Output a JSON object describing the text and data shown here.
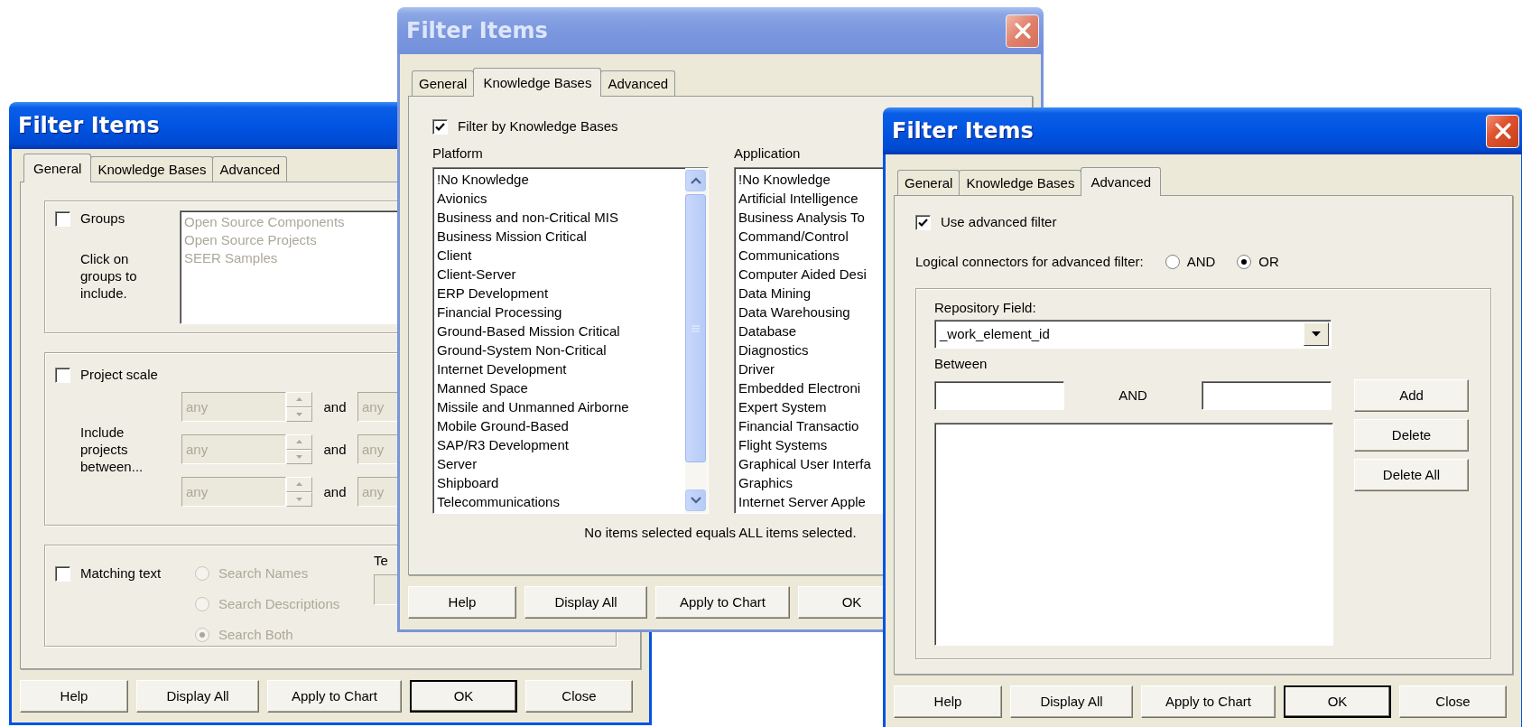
{
  "windows": [
    {
      "title": "Filter Items",
      "active": true,
      "tabs": [
        {
          "label": "General",
          "selected": true
        },
        {
          "label": "Knowledge Bases",
          "selected": false
        },
        {
          "label": "Advanced",
          "selected": false
        }
      ],
      "panel": {
        "kind": "general",
        "groups": {
          "label": "Groups",
          "checked": false,
          "hint": "Click on groups to include.",
          "disabled": true,
          "items": [
            "Open Source Components",
            "Open Source Projects",
            "SEER Samples"
          ]
        },
        "project_scale": {
          "label": "Project scale",
          "checked": false,
          "hint": "Include projects between...",
          "rows": [
            {
              "from": "any",
              "joiner": "and",
              "to": "any",
              "disabled": true
            },
            {
              "from": "any",
              "joiner": "and",
              "to": "any",
              "disabled": true
            },
            {
              "from": "any",
              "joiner": "and",
              "to": "any",
              "disabled": true
            }
          ]
        },
        "matching_text": {
          "label": "Matching text",
          "checked": false,
          "options": [
            {
              "label": "Search Names",
              "selected": false,
              "disabled": true
            },
            {
              "label": "Search Descriptions",
              "selected": false,
              "disabled": true
            },
            {
              "label": "Search Both",
              "selected": true,
              "disabled": true
            }
          ],
          "field": {
            "label": "Te",
            "disabled": true
          }
        }
      },
      "buttons": [
        {
          "label": "Help",
          "default": false
        },
        {
          "label": "Display All",
          "default": false
        },
        {
          "label": "Apply to Chart",
          "default": false
        },
        {
          "label": "OK",
          "default": true
        },
        {
          "label": "Close",
          "default": false
        }
      ]
    },
    {
      "title": "Filter Items",
      "active": false,
      "close_button": true,
      "tabs": [
        {
          "label": "General",
          "selected": false
        },
        {
          "label": "Knowledge Bases",
          "selected": true
        },
        {
          "label": "Advanced",
          "selected": false
        }
      ],
      "panel": {
        "kind": "knowledge_bases",
        "filter": {
          "label": "Filter by Knowledge Bases",
          "checked": true
        },
        "lists": [
          {
            "title": "Platform",
            "scrollbar": true,
            "items": [
              "!No Knowledge",
              "Avionics",
              "Business and non-Critical MIS",
              "Business Mission Critical",
              "Client",
              "Client-Server",
              "ERP Development",
              "Financial Processing",
              "Ground-Based Mission Critical",
              "Ground-System Non-Critical",
              "Internet Development",
              "Manned Space",
              "Missile and Unmanned Airborne",
              "Mobile Ground-Based",
              "SAP/R3 Development",
              "Server",
              "Shipboard",
              "Telecommunications"
            ]
          },
          {
            "title": "Application",
            "items": [
              "!No Knowledge",
              "Artificial Intelligence",
              "Business Analysis To",
              "Command/Control",
              "Communications",
              "Computer Aided Desi",
              "Data Mining",
              "Data Warehousing",
              "Database",
              "Diagnostics",
              "Driver",
              "Embedded Electroni",
              "Expert System",
              "Financial Transactio",
              "Flight Systems",
              "Graphical User Interfa",
              "Graphics",
              "Internet Server Apple"
            ]
          }
        ],
        "note": "No items selected equals ALL items selected."
      },
      "buttons": [
        {
          "label": "Help",
          "default": false
        },
        {
          "label": "Display All",
          "default": false
        },
        {
          "label": "Apply to Chart",
          "default": false
        },
        {
          "label": "OK",
          "default": false
        }
      ]
    },
    {
      "title": "Filter Items",
      "active": true,
      "close_button": true,
      "tabs": [
        {
          "label": "General",
          "selected": false
        },
        {
          "label": "Knowledge Bases",
          "selected": false
        },
        {
          "label": "Advanced",
          "selected": true
        }
      ],
      "panel": {
        "kind": "advanced",
        "use_filter": {
          "label": "Use advanced filter",
          "checked": true
        },
        "connectors": {
          "label": "Logical connectors for advanced filter:",
          "options": [
            {
              "label": "AND",
              "selected": false
            },
            {
              "label": "OR",
              "selected": true
            }
          ]
        },
        "field_label": "Repository Field:",
        "field_value": "_work_element_id",
        "between_label": "Between",
        "between_joiner": "AND",
        "side_buttons": [
          "Add",
          "Delete",
          "Delete All"
        ]
      },
      "buttons": [
        {
          "label": "Help",
          "default": false
        },
        {
          "label": "Display All",
          "default": false
        },
        {
          "label": "Apply to Chart",
          "default": false
        },
        {
          "label": "OK",
          "default": true
        },
        {
          "label": "Close",
          "default": false
        }
      ]
    }
  ]
}
